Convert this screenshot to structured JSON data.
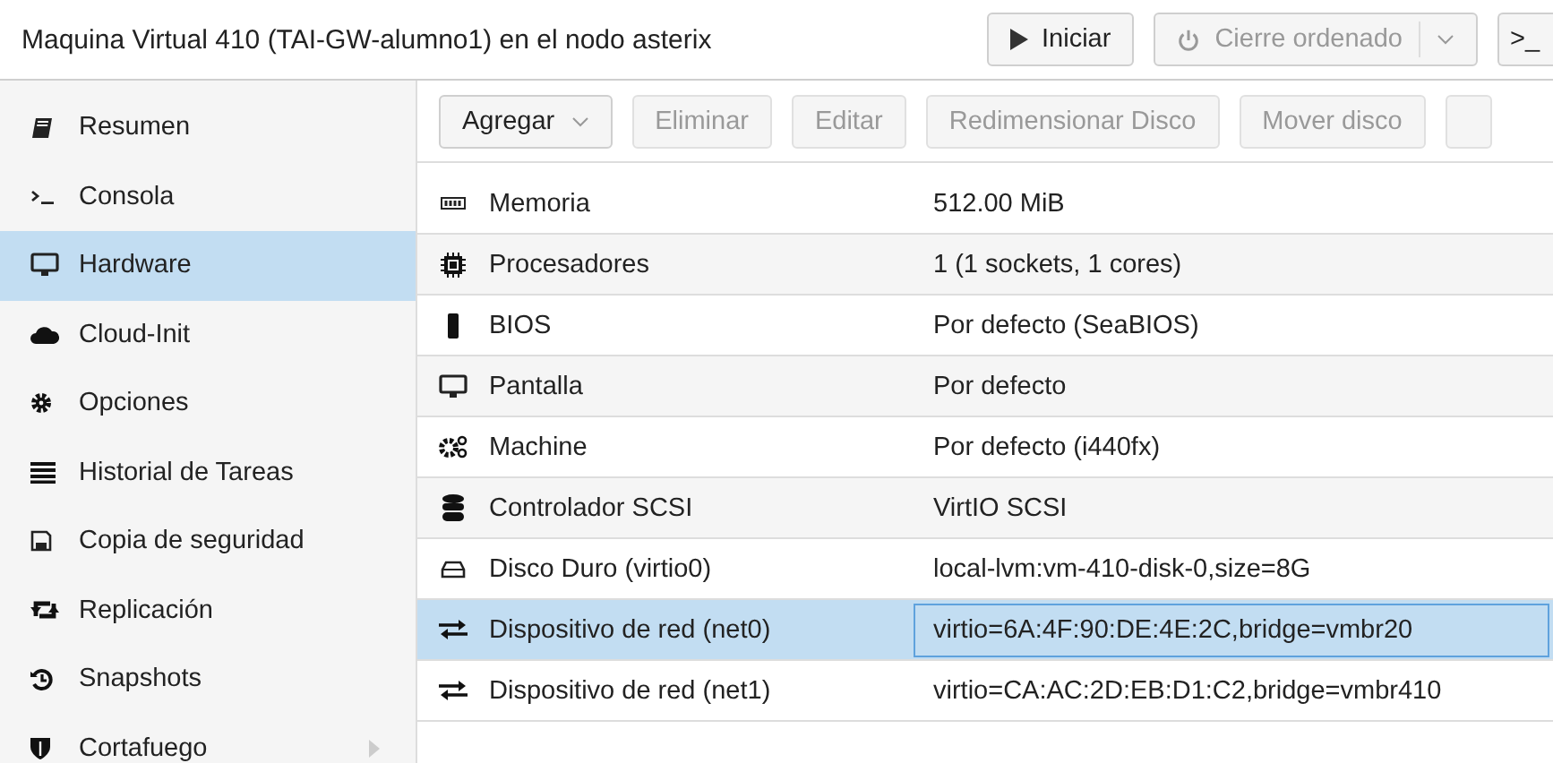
{
  "header": {
    "title": "Maquina Virtual 410 (TAI-GW-alumno1) en el nodo asterix",
    "buttons": [
      {
        "label": "Iniciar",
        "kind": "start",
        "disabled": false
      },
      {
        "label": "Cierre ordenado",
        "kind": "split",
        "disabled": true
      },
      {
        "label": ">_",
        "kind": "console",
        "disabled": false
      }
    ]
  },
  "sidebar": {
    "items": [
      {
        "label": "Resumen",
        "selected": false
      },
      {
        "label": "Consola",
        "selected": false
      },
      {
        "label": "Hardware",
        "selected": true
      },
      {
        "label": "Cloud-Init",
        "selected": false
      },
      {
        "label": "Opciones",
        "selected": false
      },
      {
        "label": "Historial de Tareas",
        "selected": false
      },
      {
        "label": "Copia de seguridad",
        "selected": false
      },
      {
        "label": "Replicación",
        "selected": false
      },
      {
        "label": "Snapshots",
        "selected": false
      },
      {
        "label": "Cortafuego",
        "selected": false,
        "expanded": false
      }
    ]
  },
  "toolbar": {
    "buttons": [
      {
        "label": "Agregar",
        "kind": "menu",
        "disabled": false
      },
      {
        "label": "Eliminar",
        "kind": "plain",
        "disabled": true
      },
      {
        "label": "Editar",
        "kind": "plain",
        "disabled": true
      },
      {
        "label": "Redimensionar Disco",
        "kind": "plain",
        "disabled": true
      },
      {
        "label": "Mover disco",
        "kind": "plain",
        "disabled": true
      },
      {
        "kind": "cut",
        "disabled": true
      }
    ]
  },
  "table": {
    "rows": [
      {
        "name": "Memoria",
        "value": "512.00 MiB",
        "selected": false
      },
      {
        "name": "Procesadores",
        "value": "1 (1 sockets, 1 cores)",
        "selected": false
      },
      {
        "name": "BIOS",
        "value": "Por defecto (SeaBIOS)",
        "selected": false
      },
      {
        "name": "Pantalla",
        "value": "Por defecto",
        "selected": false
      },
      {
        "name": "Machine",
        "value": "Por defecto (i440fx)",
        "selected": false
      },
      {
        "name": "Controlador SCSI",
        "value": "VirtIO SCSI",
        "selected": false
      },
      {
        "name": "Disco Duro (virtio0)",
        "value": "local-lvm:vm-410-disk-0,size=8G",
        "selected": false
      },
      {
        "name": "Dispositivo de red (net0)",
        "value": "virtio=6A:4F:90:DE:4E:2C,bridge=vmbr20",
        "selected": true
      },
      {
        "name": "Dispositivo de red (net1)",
        "value": "virtio=CA:AC:2D:EB:D1:C2,bridge=vmbr410",
        "selected": false
      }
    ]
  }
}
